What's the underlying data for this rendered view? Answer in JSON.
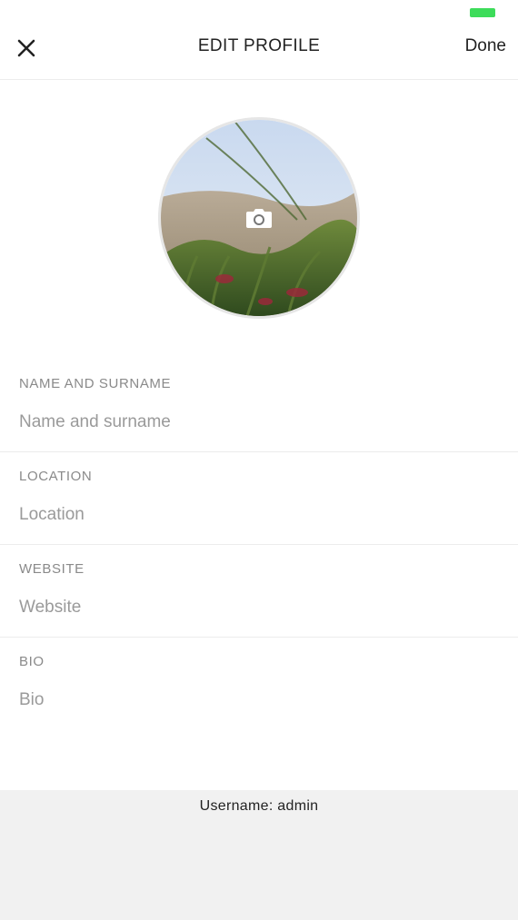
{
  "status_bar": {
    "battery_color": "#3ddc5a"
  },
  "header": {
    "close_icon": "close-icon",
    "title": "EDIT PROFILE",
    "done_label": "Done"
  },
  "avatar": {
    "photo": "profile-photo",
    "camera_icon": "camera-icon"
  },
  "form": {
    "name": {
      "label": "NAME AND SURNAME",
      "placeholder": "Name and surname",
      "value": ""
    },
    "location": {
      "label": "LOCATION",
      "placeholder": "Location",
      "value": ""
    },
    "website": {
      "label": "WEBSITE",
      "placeholder": "Website",
      "value": ""
    },
    "bio": {
      "label": "BIO",
      "placeholder": "Bio",
      "value": ""
    }
  },
  "footer": {
    "username_text": "Username: admin"
  }
}
